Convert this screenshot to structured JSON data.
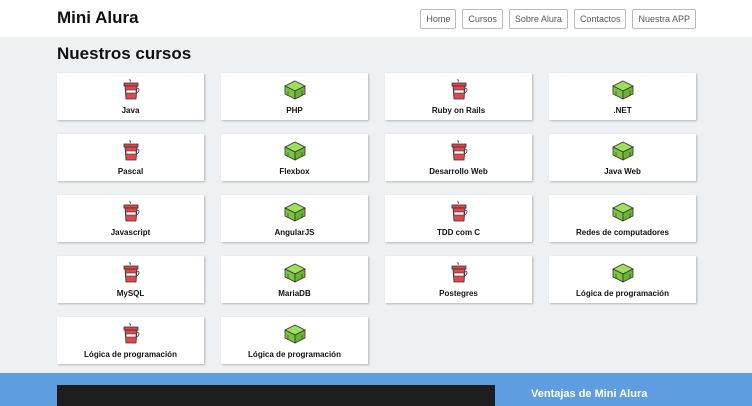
{
  "header": {
    "brand": "Mini Alura",
    "nav": [
      "Home",
      "Cursos",
      "Sobre Alura",
      "Contactos",
      "Nuestra APP"
    ]
  },
  "main": {
    "title": "Nuestros cursos",
    "courses": [
      {
        "label": "Java",
        "icon": "flask-icon"
      },
      {
        "label": "PHP",
        "icon": "cube-icon"
      },
      {
        "label": "Ruby on Rails",
        "icon": "flask-icon"
      },
      {
        "label": ".NET",
        "icon": "cube-icon"
      },
      {
        "label": "Pascal",
        "icon": "flask-icon"
      },
      {
        "label": "Flexbox",
        "icon": "cube-icon"
      },
      {
        "label": "Desarrollo Web",
        "icon": "flask-icon"
      },
      {
        "label": "Java Web",
        "icon": "cube-icon"
      },
      {
        "label": "Javascript",
        "icon": "flask-icon"
      },
      {
        "label": "AngularJS",
        "icon": "cube-icon"
      },
      {
        "label": "TDD com C",
        "icon": "flask-icon"
      },
      {
        "label": "Redes de computadores",
        "icon": "cube-icon"
      },
      {
        "label": "MySQL",
        "icon": "flask-icon"
      },
      {
        "label": "MariaDB",
        "icon": "cube-icon"
      },
      {
        "label": "Postegres",
        "icon": "flask-icon"
      },
      {
        "label": "Lógica de programación",
        "icon": "cube-icon"
      },
      {
        "label": "Lógica de programación",
        "icon": "flask-icon"
      },
      {
        "label": "Lógica de programación",
        "icon": "cube-icon"
      }
    ]
  },
  "footer": {
    "title": "Ventajas de Mini Alura"
  },
  "colors": {
    "flask": "#e0484f",
    "cube": "#8bd34a",
    "footer_bg": "#5d9de0"
  }
}
